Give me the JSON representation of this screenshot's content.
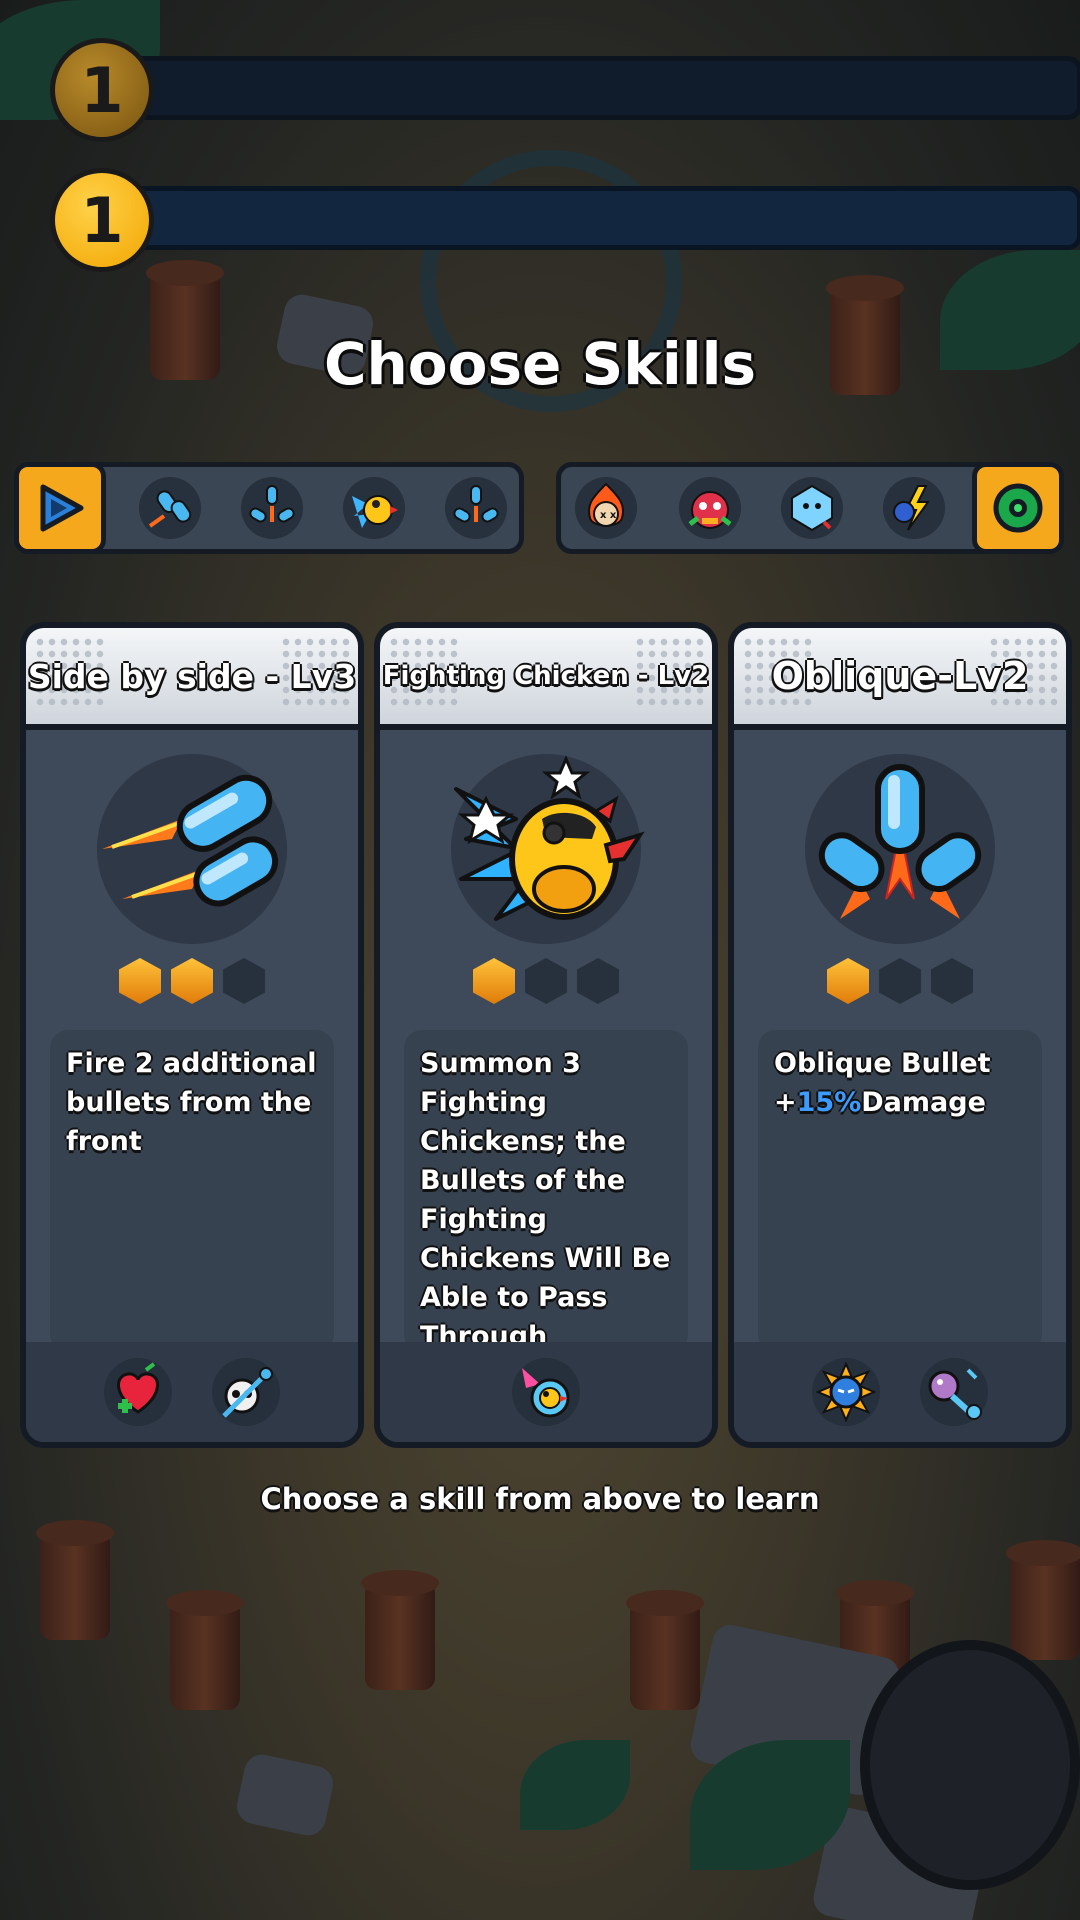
{
  "levels": [
    {
      "value": "1",
      "state": "dim"
    },
    {
      "value": "1",
      "state": "active"
    }
  ],
  "title": "Choose Skills",
  "skill_tray": {
    "left_button_icon": "play-triangle-icon",
    "left_icons": [
      "side-bullets-icon",
      "oblique-bullets-icon",
      "fighting-chicken-icon",
      "oblique-bullets-icon"
    ],
    "right_icons": [
      "fire-skull-icon",
      "angry-red-chicken-icon",
      "ice-crystal-icon",
      "lightning-potion-icon"
    ],
    "right_button_icon": "green-ring-icon"
  },
  "cards": [
    {
      "name": "Side by side - Lv3",
      "art_icon": "side-bullets-icon",
      "stars_filled": 2,
      "stars_total": 3,
      "description": "Fire 2 additional bullets from the front",
      "synergy_icons": [
        "heart-plus-icon",
        "skull-arrow-icon"
      ]
    },
    {
      "name": "Fighting Chicken - Lv2",
      "art_icon": "fighting-chicken-icon",
      "stars_filled": 1,
      "stars_total": 3,
      "description": "Summon 3 Fighting Chickens; the Bullets of the Fighting Chickens Will Be Able to Pass Through Obstacles",
      "synergy_icons": [
        "chicken-dash-icon"
      ]
    },
    {
      "name": "Oblique-Lv2",
      "art_icon": "oblique-bullets-icon",
      "stars_filled": 1,
      "stars_total": 3,
      "description_prefix": "Oblique Bullet +",
      "description_highlight": "15%",
      "description_suffix": "Damage",
      "synergy_icons": [
        "blue-fire-orb-icon",
        "potion-key-icon"
      ]
    }
  ],
  "hint": "Choose a skill from above to learn",
  "colors": {
    "accent": "#f5a81c",
    "highlight": "#3c9bff",
    "card_body": "#3e4a5a",
    "outline": "#151b24"
  }
}
